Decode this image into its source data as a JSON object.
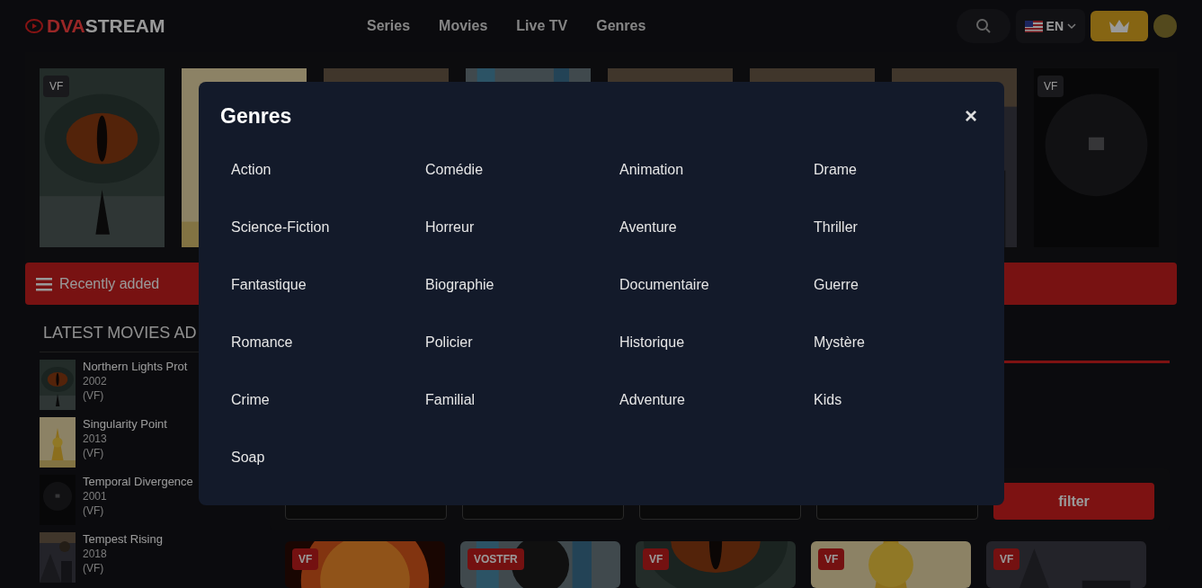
{
  "header": {
    "logo": {
      "part_1": "DVA",
      "part_2": "STREAM"
    },
    "nav": [
      "Series",
      "Movies",
      "Live TV",
      "Genres"
    ],
    "language": "EN"
  },
  "posters": [
    {
      "kind": "picture",
      "badge": "VF"
    },
    {
      "kind": "picture"
    },
    {
      "kind": "picture"
    },
    {
      "kind": "picture"
    },
    {
      "kind": "picture"
    },
    {
      "kind": "picture"
    },
    {
      "kind": "picture"
    },
    {
      "kind": "picture",
      "badge": "VF"
    }
  ],
  "recent_bar": {
    "label": "Recently added"
  },
  "sidebar": {
    "title": "LATEST MOVIES AD",
    "items": [
      {
        "title": "Northern Lights Prot",
        "year": "2002",
        "version": "(VF)"
      },
      {
        "title": "Singularity Point",
        "year": "2013",
        "version": "(VF)"
      },
      {
        "title": "Temporal Divergence",
        "year": "2001",
        "version": "(VF)"
      },
      {
        "title": "Tempest Rising",
        "year": "2018",
        "version": "(VF)"
      }
    ]
  },
  "filter": {
    "button": "filter"
  },
  "cards": [
    {
      "badge": "VF"
    },
    {
      "badge": "VOSTFR"
    },
    {
      "badge": "VF"
    },
    {
      "badge": "VF"
    },
    {
      "badge": "VF"
    }
  ],
  "modal": {
    "title": "Genres",
    "close": "×",
    "genres": [
      "Action",
      "Comédie",
      "Animation",
      "Drame",
      "Science-Fiction",
      "Horreur",
      "Aventure",
      "Thriller",
      "Fantastique",
      "Biographie",
      "Documentaire",
      "Guerre",
      "Romance",
      "Policier",
      "Historique",
      "Mystère",
      "Crime",
      "Familial",
      "Adventure",
      "Kids",
      "Soap"
    ]
  }
}
